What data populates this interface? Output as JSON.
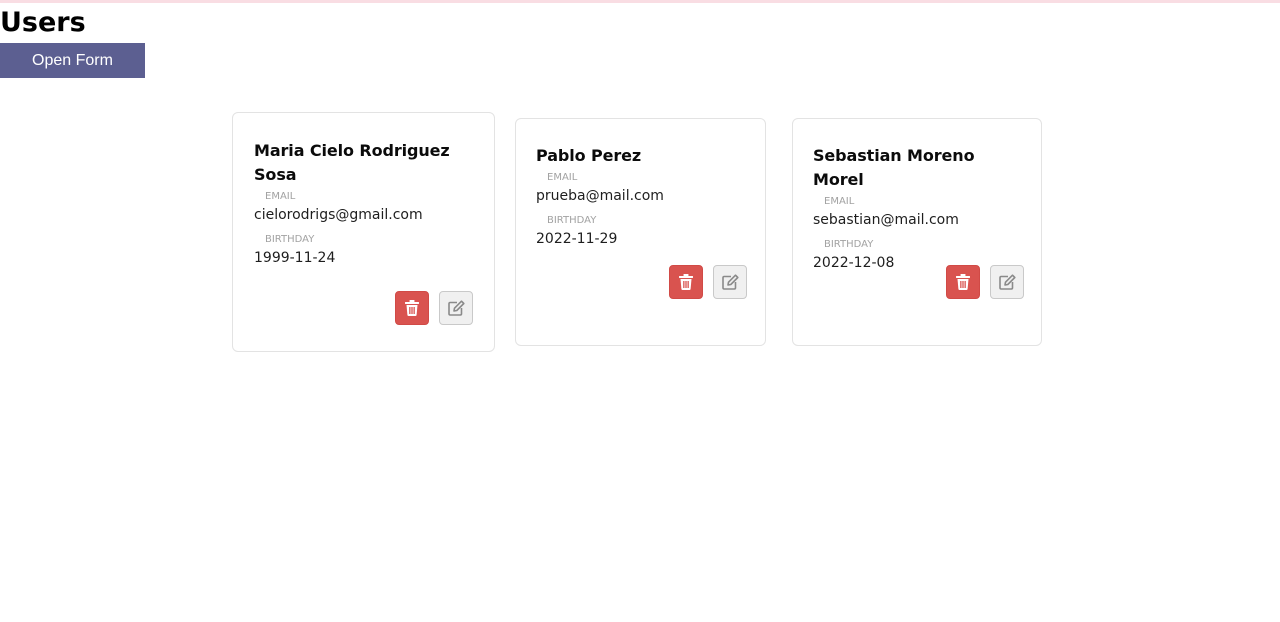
{
  "page": {
    "title": "Users",
    "open_form_label": "Open Form"
  },
  "labels": {
    "email": "EMAIL",
    "birthday": "BIRTHDAY"
  },
  "users": [
    {
      "name": "Maria Cielo Rodriguez Sosa",
      "email": "cielorodrigs@gmail.com",
      "birthday": "1999-11-24"
    },
    {
      "name": "Pablo Perez",
      "email": "prueba@mail.com",
      "birthday": "2022-11-29"
    },
    {
      "name": "Sebastian Moreno Morel",
      "email": "sebastian@mail.com",
      "birthday": "2022-12-08"
    }
  ],
  "icons": {
    "delete": "trash-icon",
    "edit": "edit-icon"
  },
  "colors": {
    "button_primary": "#5c5f91",
    "delete": "#d9534f",
    "edit_bg": "#f0f0f0"
  }
}
